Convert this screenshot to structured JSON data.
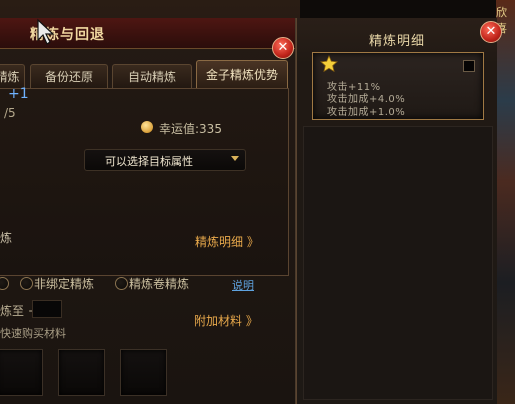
{
  "main": {
    "title": "精炼与回退",
    "close_glyph": "✕",
    "tabs": [
      {
        "label": "精炼"
      },
      {
        "label": "备份还原"
      },
      {
        "label": "自动精炼"
      },
      {
        "label": "金子精炼优势"
      }
    ],
    "level_plus": "+1",
    "count_fragment": "/5",
    "luck_label": "幸运值:335",
    "select_label": "可以选择目标属性",
    "side_fragment": "炼",
    "detail_link": "精炼明细 》",
    "radio_options": [
      {
        "label": "非绑定精炼"
      },
      {
        "label": "精炼卷精炼"
      }
    ],
    "help_link": "说明",
    "refine_to_label": "炼至 +",
    "quick_buy_label": "快速购买材料",
    "add_material_link": "附加材料 》"
  },
  "detail": {
    "title": "精炼明细",
    "close_glyph": "✕",
    "lines": [
      "攻击+11%",
      "攻击加成+4.0%",
      "攻击加成+1.0%"
    ]
  },
  "scene": {
    "fragment": "欣喜"
  },
  "icons": {
    "luck": "smiley-icon",
    "star": "star-icon",
    "close": "close-icon",
    "cursor": "cursor-icon"
  },
  "colors": {
    "link": "#e7a84b",
    "help_link": "#5fa3e0",
    "close": "#c0241a",
    "plus_text": "#6fb2ff"
  }
}
